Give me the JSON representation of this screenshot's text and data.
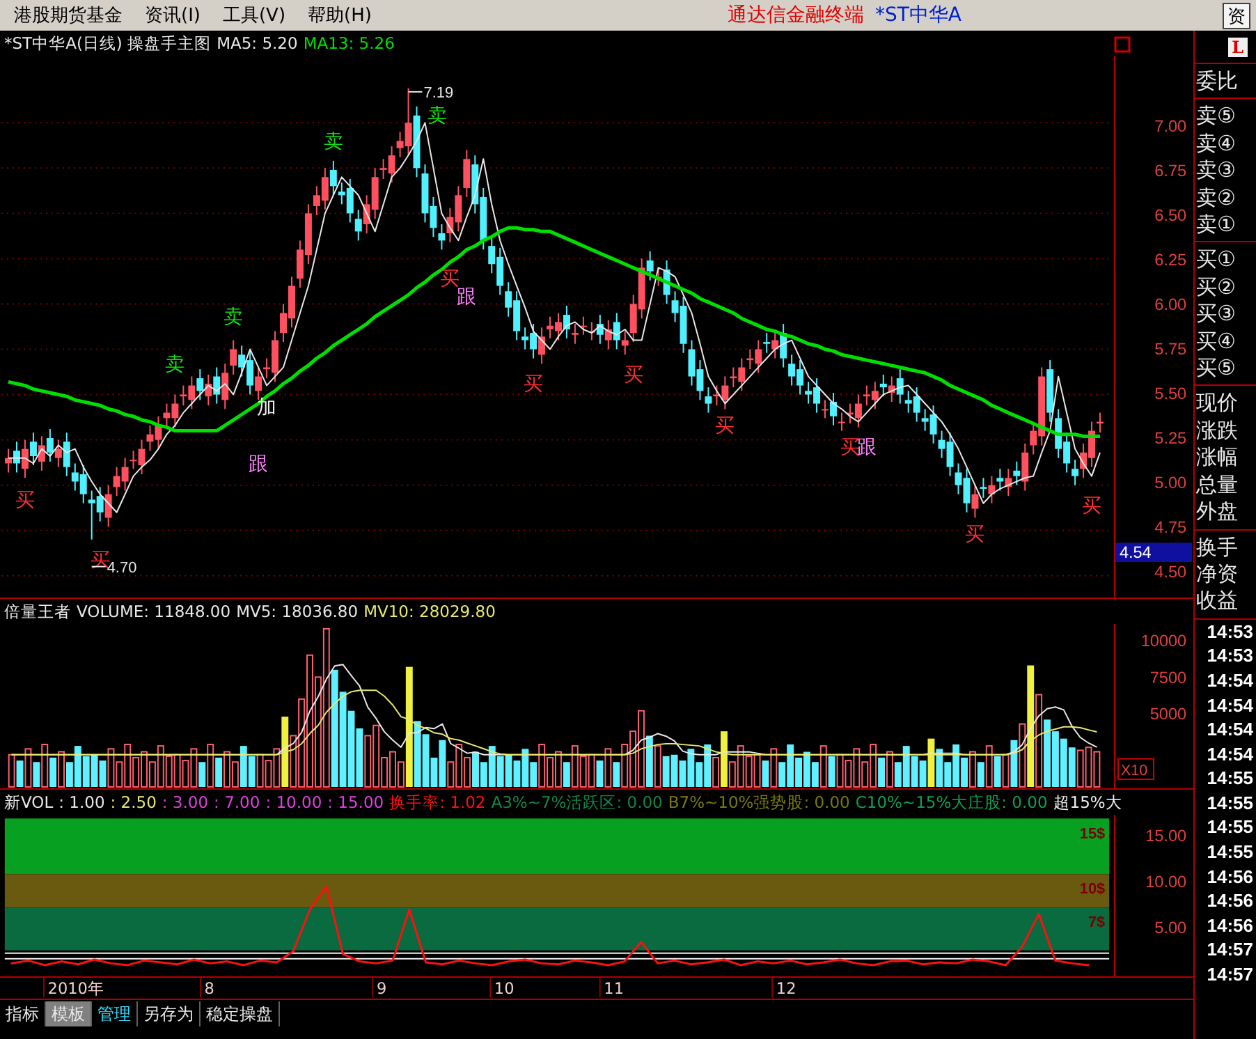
{
  "menu_bar": {
    "items": [
      "港股期货基金",
      "资讯(I)",
      "工具(V)",
      "帮助(H)"
    ],
    "app_title": "通达信金融终端",
    "stock_name": "*ST中华A",
    "corner_button": "资"
  },
  "price_pane": {
    "legend": [
      {
        "text": "*ST中华A(日线) 操盘手主图",
        "color": "#e8e8e8"
      }
    ],
    "current_price": "4.54",
    "chart_data": {
      "type": "candlestick",
      "ylim": [
        4.38,
        7.37
      ],
      "grid": true,
      "yticks": [
        {
          "value": 7,
          "label": "7.00"
        },
        {
          "value": 6.75,
          "label": "6.75"
        },
        {
          "value": 6.5,
          "label": "6.50"
        },
        {
          "value": 6.25,
          "label": "6.25"
        },
        {
          "value": 6,
          "label": "6.00"
        },
        {
          "value": 5.75,
          "label": "5.75"
        },
        {
          "value": 5.5,
          "label": "5.50"
        },
        {
          "value": 5.25,
          "label": "5.25"
        },
        {
          "value": 5,
          "label": "5.00"
        },
        {
          "value": 4.75,
          "label": "4.75"
        },
        {
          "value": 4.5,
          "label": "4.50"
        }
      ],
      "ohlc": [
        [
          5.12,
          5.2,
          5.07,
          5.15
        ],
        [
          5.19,
          5.24,
          5.07,
          5.12
        ],
        [
          5.09,
          5.25,
          5.04,
          5.2
        ],
        [
          5.24,
          5.29,
          5.11,
          5.16
        ],
        [
          5.13,
          5.27,
          5.08,
          5.22
        ],
        [
          5.26,
          5.31,
          5.13,
          5.18
        ],
        [
          5.15,
          5.25,
          5.1,
          5.2
        ],
        [
          5.24,
          5.29,
          5.05,
          5.1
        ],
        [
          5.07,
          5.12,
          4.97,
          5.02
        ],
        [
          5.06,
          5.11,
          4.9,
          4.95
        ],
        [
          4.92,
          4.97,
          4.7,
          4.9
        ],
        [
          4.94,
          4.99,
          4.8,
          4.85
        ],
        [
          4.82,
          5.0,
          4.77,
          4.95
        ],
        [
          4.99,
          5.1,
          4.94,
          5.05
        ],
        [
          5.02,
          5.15,
          4.97,
          5.1
        ],
        [
          5.14,
          5.19,
          5.09,
          5.14
        ],
        [
          5.11,
          5.25,
          5.06,
          5.2
        ],
        [
          5.24,
          5.33,
          5.19,
          5.28
        ],
        [
          5.25,
          5.38,
          5.2,
          5.33
        ],
        [
          5.37,
          5.45,
          5.32,
          5.4
        ],
        [
          5.37,
          5.5,
          5.32,
          5.45
        ],
        [
          5.49,
          5.55,
          5.44,
          5.5
        ],
        [
          5.47,
          5.6,
          5.42,
          5.55
        ],
        [
          5.59,
          5.64,
          5.47,
          5.52
        ],
        [
          5.49,
          5.61,
          5.44,
          5.56
        ],
        [
          5.6,
          5.65,
          5.45,
          5.5
        ],
        [
          5.47,
          5.67,
          5.42,
          5.62
        ],
        [
          5.66,
          5.8,
          5.61,
          5.75
        ],
        [
          5.72,
          5.77,
          5.6,
          5.65
        ],
        [
          5.69,
          5.74,
          5.5,
          5.55
        ],
        [
          5.52,
          5.65,
          5.47,
          5.6
        ],
        [
          5.64,
          5.7,
          5.59,
          5.65
        ],
        [
          5.62,
          5.85,
          5.57,
          5.8
        ],
        [
          5.84,
          6.0,
          5.79,
          5.95
        ],
        [
          5.92,
          6.15,
          5.87,
          6.1
        ],
        [
          6.14,
          6.35,
          6.09,
          6.3
        ],
        [
          6.27,
          6.55,
          6.22,
          6.5
        ],
        [
          6.54,
          6.65,
          6.49,
          6.6
        ],
        [
          6.57,
          6.75,
          6.52,
          6.7
        ],
        [
          6.74,
          6.79,
          6.6,
          6.65
        ],
        [
          6.62,
          6.67,
          6.55,
          6.6
        ],
        [
          6.64,
          6.69,
          6.45,
          6.5
        ],
        [
          6.47,
          6.52,
          6.35,
          6.4
        ],
        [
          6.44,
          6.6,
          6.39,
          6.55
        ],
        [
          6.52,
          6.75,
          6.47,
          6.7
        ],
        [
          6.74,
          6.8,
          6.69,
          6.75
        ],
        [
          6.72,
          6.87,
          6.67,
          6.82
        ],
        [
          6.86,
          6.95,
          6.81,
          6.9
        ],
        [
          6.87,
          7.19,
          6.82,
          7.0
        ],
        [
          7.04,
          7.09,
          6.7,
          6.75
        ],
        [
          6.72,
          6.77,
          6.45,
          6.5
        ],
        [
          6.54,
          6.59,
          6.37,
          6.42
        ],
        [
          6.39,
          6.44,
          6.3,
          6.35
        ],
        [
          6.39,
          6.53,
          6.34,
          6.48
        ],
        [
          6.45,
          6.65,
          6.4,
          6.6
        ],
        [
          6.64,
          6.85,
          6.59,
          6.8
        ],
        [
          6.77,
          6.82,
          6.5,
          6.55
        ],
        [
          6.59,
          6.64,
          6.3,
          6.35
        ],
        [
          6.32,
          6.37,
          6.17,
          6.22
        ],
        [
          6.26,
          6.31,
          6.05,
          6.1
        ],
        [
          6.07,
          6.12,
          5.93,
          5.98
        ],
        [
          6.02,
          6.07,
          5.8,
          5.85
        ],
        [
          5.82,
          5.87,
          5.75,
          5.8
        ],
        [
          5.84,
          5.89,
          5.7,
          5.75
        ],
        [
          5.72,
          5.87,
          5.67,
          5.82
        ],
        [
          5.86,
          5.93,
          5.81,
          5.88
        ],
        [
          5.85,
          5.95,
          5.8,
          5.9
        ],
        [
          5.94,
          5.99,
          5.81,
          5.86
        ],
        [
          5.83,
          5.89,
          5.78,
          5.84
        ],
        [
          5.88,
          5.93,
          5.83,
          5.88
        ],
        [
          5.85,
          5.9,
          5.8,
          5.85
        ],
        [
          5.89,
          5.94,
          5.78,
          5.83
        ],
        [
          5.8,
          5.91,
          5.75,
          5.86
        ],
        [
          5.9,
          5.95,
          5.75,
          5.8
        ],
        [
          5.77,
          5.85,
          5.72,
          5.8
        ],
        [
          5.84,
          6.05,
          5.79,
          6.0
        ],
        [
          5.97,
          6.25,
          5.92,
          6.2
        ],
        [
          6.24,
          6.29,
          6.13,
          6.18
        ],
        [
          6.15,
          6.2,
          6.1,
          6.15
        ],
        [
          6.19,
          6.24,
          6.0,
          6.05
        ],
        [
          6.02,
          6.07,
          5.9,
          5.95
        ],
        [
          5.99,
          6.04,
          5.73,
          5.78
        ],
        [
          5.75,
          5.8,
          5.55,
          5.6
        ],
        [
          5.64,
          5.69,
          5.47,
          5.52
        ],
        [
          5.49,
          5.54,
          5.4,
          5.45
        ],
        [
          5.49,
          5.55,
          5.44,
          5.5
        ],
        [
          5.47,
          5.6,
          5.42,
          5.55
        ],
        [
          5.59,
          5.65,
          5.54,
          5.6
        ],
        [
          5.57,
          5.7,
          5.52,
          5.65
        ],
        [
          5.69,
          5.75,
          5.64,
          5.7
        ],
        [
          5.67,
          5.8,
          5.62,
          5.75
        ],
        [
          5.79,
          5.84,
          5.73,
          5.78
        ],
        [
          5.75,
          5.85,
          5.7,
          5.8
        ],
        [
          5.84,
          5.89,
          5.65,
          5.7
        ],
        [
          5.67,
          5.72,
          5.55,
          5.6
        ],
        [
          5.64,
          5.69,
          5.5,
          5.55
        ],
        [
          5.52,
          5.57,
          5.45,
          5.5
        ],
        [
          5.54,
          5.59,
          5.4,
          5.45
        ],
        [
          5.42,
          5.47,
          5.37,
          5.42
        ],
        [
          5.46,
          5.51,
          5.33,
          5.38
        ],
        [
          5.35,
          5.4,
          5.3,
          5.35
        ],
        [
          5.39,
          5.45,
          5.34,
          5.4
        ],
        [
          5.37,
          5.5,
          5.32,
          5.45
        ],
        [
          5.49,
          5.55,
          5.44,
          5.5
        ],
        [
          5.47,
          5.57,
          5.42,
          5.52
        ],
        [
          5.56,
          5.61,
          5.49,
          5.54
        ],
        [
          5.51,
          5.6,
          5.46,
          5.55
        ],
        [
          5.59,
          5.64,
          5.45,
          5.5
        ],
        [
          5.47,
          5.52,
          5.4,
          5.45
        ],
        [
          5.49,
          5.54,
          5.35,
          5.4
        ],
        [
          5.37,
          5.42,
          5.3,
          5.35
        ],
        [
          5.39,
          5.44,
          5.23,
          5.28
        ],
        [
          5.25,
          5.3,
          5.15,
          5.2
        ],
        [
          5.24,
          5.29,
          5.05,
          5.1
        ],
        [
          5.07,
          5.12,
          4.95,
          5.0
        ],
        [
          5.04,
          5.09,
          4.85,
          4.9
        ],
        [
          4.87,
          5.0,
          4.82,
          4.95
        ],
        [
          4.99,
          5.04,
          4.93,
          4.98
        ],
        [
          4.95,
          5.05,
          4.9,
          5.0
        ],
        [
          5.04,
          5.09,
          4.97,
          5.02
        ],
        [
          4.99,
          5.09,
          4.94,
          5.04
        ],
        [
          5.08,
          5.13,
          5.0,
          5.05
        ],
        [
          5.02,
          5.23,
          4.97,
          5.18
        ],
        [
          5.22,
          5.35,
          5.17,
          5.3
        ],
        [
          5.27,
          5.65,
          5.22,
          5.6
        ],
        [
          5.64,
          5.69,
          5.35,
          5.4
        ],
        [
          5.37,
          5.42,
          5.15,
          5.2
        ],
        [
          5.24,
          5.29,
          5.07,
          5.12
        ],
        [
          5.09,
          5.14,
          5.0,
          5.05
        ],
        [
          5.09,
          5.23,
          5.04,
          5.18
        ],
        [
          5.15,
          5.35,
          5.1,
          5.3
        ],
        [
          5.34,
          5.4,
          5.29,
          5.35
        ]
      ],
      "series": [
        {
          "name": "MA5: 5.20",
          "type": "line",
          "color": "#e8e8e8",
          "values": [
            5.15,
            5.15,
            5.15,
            5.12,
            5.2,
            5.16,
            5.22,
            5.18,
            5.2,
            5.1,
            5.02,
            4.95,
            4.9,
            4.85,
            4.95,
            5.05,
            5.1,
            5.14,
            5.2,
            5.28,
            5.33,
            5.4,
            5.45,
            5.5,
            5.55,
            5.52,
            5.56,
            5.5,
            5.62,
            5.75,
            5.65,
            5.55,
            5.6,
            5.65,
            5.8,
            5.95,
            6.1,
            6.3,
            6.5,
            6.6,
            6.7,
            6.65,
            6.6,
            6.5,
            6.4,
            6.55,
            6.7,
            6.75,
            6.82,
            6.9,
            7.0,
            6.75,
            6.5,
            6.42,
            6.35,
            6.48,
            6.6,
            6.8,
            6.55,
            6.35,
            6.22,
            6.1,
            5.98,
            5.85,
            5.8,
            5.75,
            5.82,
            5.88,
            5.9,
            5.86,
            5.84,
            5.88,
            5.85,
            5.83,
            5.86,
            5.8,
            5.8,
            6.0,
            6.2,
            6.18,
            6.15,
            6.05,
            5.95,
            5.78,
            5.6,
            5.52,
            5.45,
            5.5,
            5.55,
            5.6,
            5.65,
            5.7,
            5.75,
            5.78,
            5.8,
            5.7,
            5.6,
            5.55,
            5.5,
            5.45,
            5.42,
            5.38,
            5.35,
            5.4,
            5.45,
            5.5,
            5.52,
            5.54,
            5.55,
            5.5,
            5.45,
            5.4,
            5.35,
            5.28,
            5.2,
            5.1,
            5.0,
            4.9,
            4.95,
            4.98,
            5.0,
            5.02,
            5.04,
            5.05,
            5.18,
            5.3,
            5.6,
            5.4,
            5.2,
            5.12,
            5.05,
            5.18
          ]
        },
        {
          "name": "MA13: 5.26",
          "type": "line",
          "color": "#00e000",
          "values": [
            5.57,
            5.56,
            5.55,
            5.53,
            5.52,
            5.51,
            5.5,
            5.49,
            5.47,
            5.46,
            5.45,
            5.44,
            5.42,
            5.41,
            5.39,
            5.38,
            5.36,
            5.35,
            5.33,
            5.32,
            5.3,
            5.3,
            5.3,
            5.3,
            5.3,
            5.3,
            5.33,
            5.36,
            5.39,
            5.42,
            5.45,
            5.49,
            5.52,
            5.56,
            5.59,
            5.63,
            5.66,
            5.7,
            5.73,
            5.77,
            5.8,
            5.83,
            5.86,
            5.89,
            5.93,
            5.96,
            5.99,
            6.02,
            6.05,
            6.09,
            6.12,
            6.16,
            6.19,
            6.23,
            6.26,
            6.3,
            6.32,
            6.35,
            6.37,
            6.4,
            6.42,
            6.42,
            6.41,
            6.41,
            6.4,
            6.4,
            6.38,
            6.36,
            6.34,
            6.32,
            6.3,
            6.28,
            6.26,
            6.24,
            6.22,
            6.2,
            6.18,
            6.16,
            6.14,
            6.12,
            6.1,
            6.08,
            6.06,
            6.03,
            6.01,
            5.99,
            5.97,
            5.95,
            5.92,
            5.9,
            5.88,
            5.86,
            5.85,
            5.83,
            5.82,
            5.8,
            5.78,
            5.77,
            5.75,
            5.74,
            5.72,
            5.71,
            5.7,
            5.69,
            5.68,
            5.67,
            5.66,
            5.65,
            5.64,
            5.63,
            5.62,
            5.6,
            5.58,
            5.55,
            5.53,
            5.51,
            5.49,
            5.47,
            5.44,
            5.42,
            5.4,
            5.38,
            5.36,
            5.34,
            5.32,
            5.3,
            5.28,
            5.28,
            5.28,
            5.27,
            5.27,
            5.27
          ]
        }
      ]
    },
    "markers": [
      {
        "text": "买",
        "kind": "buy"
      },
      {
        "text": "买",
        "kind": "buy"
      },
      {
        "text": "4.70",
        "kind": "low"
      },
      {
        "text": "卖",
        "kind": "sell"
      },
      {
        "text": "卖",
        "kind": "sell"
      },
      {
        "text": "加",
        "kind": "add"
      },
      {
        "text": "跟",
        "kind": "follow"
      },
      {
        "text": "卖",
        "kind": "sell"
      },
      {
        "text": "7.19",
        "kind": "high"
      },
      {
        "text": "卖",
        "kind": "sell"
      },
      {
        "text": "买",
        "kind": "buy"
      },
      {
        "text": "跟",
        "kind": "follow"
      },
      {
        "text": "买",
        "kind": "buy"
      },
      {
        "text": "买",
        "kind": "buy"
      },
      {
        "text": "买",
        "kind": "buy"
      },
      {
        "text": "买",
        "kind": "buy"
      },
      {
        "text": "跟",
        "kind": "follow"
      },
      {
        "text": "买",
        "kind": "buy"
      },
      {
        "text": "买",
        "kind": "buy"
      }
    ]
  },
  "volume_pane": {
    "legend": [
      {
        "text": "倍量王者",
        "color": "#e8e8e8"
      }
    ],
    "chart_data": {
      "type": "bar",
      "ylim": [
        0,
        11130
      ],
      "yticks": [
        {
          "value": 10000,
          "label": "10000"
        },
        {
          "value": 7500,
          "label": "7500"
        },
        {
          "value": 5000,
          "label": "5000"
        }
      ],
      "series": [
        {
          "name": "VOLUME: 11848.00",
          "type": "bar",
          "colors": [
            "#ff6070",
            "#60f0ff",
            "#ff6070",
            "#60f0ff",
            "#ff6070",
            "#60f0ff",
            "#ff6070",
            "#60f0ff",
            "#60f0ff",
            "#60f0ff",
            "#60f0ff",
            "#60f0ff",
            "#ff6070",
            "#ff6070",
            "#ff6070",
            "#ff6070",
            "#ff6070",
            "#ff6070",
            "#ff6070",
            "#ff6070",
            "#ff6070",
            "#ff6070",
            "#ff6070",
            "#60f0ff",
            "#ff6070",
            "#60f0ff",
            "#ff6070",
            "#ff6070",
            "#60f0ff",
            "#60f0ff",
            "#ff6070",
            "#ff6070",
            "#ff6070",
            "#f0f040",
            "#ff6070",
            "#ff6070",
            "#ff6070",
            "#ff6070",
            "#ff6070",
            "#60f0ff",
            "#60f0ff",
            "#60f0ff",
            "#60f0ff",
            "#ff6070",
            "#ff6070",
            "#ff6070",
            "#ff6070",
            "#ff6070",
            "#f0f040",
            "#60f0ff",
            "#60f0ff",
            "#60f0ff",
            "#60f0ff",
            "#ff6070",
            "#ff6070",
            "#ff6070",
            "#60f0ff",
            "#60f0ff",
            "#60f0ff",
            "#60f0ff",
            "#60f0ff",
            "#60f0ff",
            "#60f0ff",
            "#60f0ff",
            "#ff6070",
            "#ff6070",
            "#ff6070",
            "#60f0ff",
            "#ff6070",
            "#ff6070",
            "#ff6070",
            "#60f0ff",
            "#ff6070",
            "#60f0ff",
            "#ff6070",
            "#ff6070",
            "#ff6070",
            "#60f0ff",
            "#ff6070",
            "#60f0ff",
            "#60f0ff",
            "#60f0ff",
            "#60f0ff",
            "#60f0ff",
            "#60f0ff",
            "#ff6070",
            "#f0f040",
            "#ff6070",
            "#ff6070",
            "#ff6070",
            "#ff6070",
            "#60f0ff",
            "#ff6070",
            "#60f0ff",
            "#60f0ff",
            "#60f0ff",
            "#60f0ff",
            "#60f0ff",
            "#ff6070",
            "#60f0ff",
            "#ff6070",
            "#ff6070",
            "#ff6070",
            "#ff6070",
            "#ff6070",
            "#60f0ff",
            "#ff6070",
            "#60f0ff",
            "#60f0ff",
            "#60f0ff",
            "#60f0ff",
            "#f0f040",
            "#60f0ff",
            "#60f0ff",
            "#60f0ff",
            "#60f0ff",
            "#ff6070",
            "#60f0ff",
            "#ff6070",
            "#60f0ff",
            "#ff6070",
            "#60f0ff",
            "#ff6070",
            "#f0f040",
            "#ff6070",
            "#60f0ff",
            "#60f0ff",
            "#60f0ff",
            "#60f0ff",
            "#ff6070",
            "#ff6070",
            "#ff6070"
          ],
          "values": [
            2200,
            1800,
            2600,
            1700,
            2900,
            2000,
            2400,
            1700,
            2800,
            2100,
            2200,
            1800,
            2600,
            1700,
            2900,
            2000,
            2400,
            1700,
            2800,
            2100,
            2200,
            1800,
            2600,
            1700,
            2900,
            2000,
            2400,
            1700,
            2800,
            2100,
            2200,
            1800,
            2600,
            4800,
            3500,
            6000,
            9000,
            7500,
            10800,
            8000,
            6500,
            5200,
            4000,
            3500,
            4200,
            2000,
            2400,
            1700,
            8200,
            4500,
            3600,
            2000,
            3200,
            1700,
            2900,
            2000,
            2400,
            1700,
            2800,
            2100,
            2200,
            1800,
            2600,
            1700,
            2900,
            2000,
            2400,
            1700,
            2800,
            2100,
            2200,
            1800,
            2600,
            1700,
            2900,
            3800,
            5200,
            3500,
            2800,
            2100,
            2200,
            1800,
            2600,
            1700,
            2900,
            2000,
            3800,
            1700,
            2800,
            2100,
            2200,
            1800,
            2600,
            1700,
            2900,
            2000,
            2400,
            1700,
            2800,
            2100,
            2200,
            1800,
            2600,
            1700,
            2900,
            2000,
            2400,
            1700,
            2800,
            2100,
            1800,
            3300,
            2600,
            1700,
            2900,
            2000,
            2400,
            1700,
            2800,
            2100,
            2200,
            3200,
            4300,
            8300,
            6300,
            4600,
            3800,
            3300,
            2700,
            2500,
            2700,
            2400
          ]
        },
        {
          "name": "MV5: 18036.80",
          "type": "line",
          "color": "#e8e8e8",
          "values": [
            2200,
            2200,
            2200,
            2200,
            2200,
            2200,
            2200,
            2200,
            2200,
            2200,
            2200,
            2200,
            2200,
            2200,
            2200,
            2200,
            2200,
            2200,
            2200,
            2200,
            2200,
            2200,
            2200,
            2200,
            2200,
            2200,
            2200,
            2200,
            2200,
            2200,
            2200,
            2200,
            2200,
            2660,
            2960,
            3720,
            5180,
            6160,
            7360,
            8260,
            8360,
            7600,
            6900,
            5440,
            4680,
            3760,
            3200,
            2720,
            3660,
            3720,
            4060,
            3980,
            4300,
            2960,
            2640,
            2300,
            2380,
            2200,
            2200,
            2200,
            2200,
            2200,
            2200,
            2200,
            2200,
            2200,
            2200,
            2200,
            2200,
            2200,
            2200,
            2200,
            2200,
            2200,
            2200,
            2500,
            3200,
            3380,
            3640,
            3460,
            3140,
            2440,
            2260,
            2200,
            2200,
            2200,
            2400,
            2400,
            2400,
            2400,
            2300,
            2200,
            2200,
            2200,
            2200,
            2200,
            2200,
            2200,
            2200,
            2200,
            2200,
            2200,
            2200,
            2200,
            2200,
            2200,
            2200,
            2200,
            2200,
            2200,
            2200,
            2300,
            2300,
            2300,
            2300,
            2200,
            2200,
            2200,
            2200,
            2200,
            2200,
            2400,
            2900,
            4000,
            4860,
            5340,
            5460,
            5260,
            4140,
            3380,
            3000,
            2720
          ]
        },
        {
          "name": "MV10: 28029.80",
          "type": "line",
          "color": "#e8e870",
          "values": [
            2200,
            2200,
            2200,
            2200,
            2200,
            2200,
            2200,
            2200,
            2200,
            2200,
            2200,
            2200,
            2200,
            2200,
            2200,
            2200,
            2200,
            2200,
            2200,
            2200,
            2200,
            2200,
            2200,
            2200,
            2200,
            2200,
            2200,
            2200,
            2200,
            2200,
            2200,
            2200,
            2200,
            2400,
            2550,
            2950,
            3650,
            4200,
            5100,
            5700,
            6200,
            6500,
            6600,
            6600,
            6600,
            6200,
            5600,
            4800,
            4600,
            4200,
            4000,
            3700,
            3600,
            3300,
            3200,
            3000,
            2800,
            2600,
            2400,
            2250,
            2200,
            2200,
            2200,
            2200,
            2200,
            2200,
            2200,
            2200,
            2200,
            2200,
            2200,
            2200,
            2200,
            2200,
            2200,
            2300,
            2600,
            2750,
            2900,
            2950,
            2950,
            2900,
            2850,
            2800,
            2600,
            2400,
            2300,
            2200,
            2200,
            2200,
            2200,
            2200,
            2200,
            2200,
            2200,
            2200,
            2200,
            2200,
            2200,
            2200,
            2200,
            2200,
            2200,
            2200,
            2200,
            2200,
            2200,
            2200,
            2200,
            2200,
            2200,
            2200,
            2200,
            2200,
            2200,
            2200,
            2200,
            2200,
            2200,
            2200,
            2200,
            2300,
            2550,
            3150,
            3550,
            3800,
            3950,
            4100,
            4100,
            4050,
            3900,
            3750
          ]
        }
      ]
    },
    "scale_label": "X10"
  },
  "indicator_pane": {
    "legend": [
      {
        "text": "新VOL",
        "color": "#e8e8e8"
      },
      {
        "text": ": 1.00",
        "color": "#e8e8e8"
      },
      {
        "text": ": 2.50",
        "color": "#e8e870"
      },
      {
        "text": ": 3.00",
        "color": "#e040e0"
      },
      {
        "text": ": 7.00",
        "color": "#e040e0"
      },
      {
        "text": ": 10.00",
        "color": "#e040e0"
      },
      {
        "text": ": 15.00",
        "color": "#e040e0"
      }
    ],
    "chart_data": {
      "type": "line",
      "ylim": [
        -0.2,
        17.2
      ],
      "yticks": [
        {
          "value": 15,
          "label": "15.00"
        },
        {
          "value": 10,
          "label": "10.00"
        },
        {
          "value": 5,
          "label": "5.00"
        }
      ],
      "bands": [
        {
          "axis": "y",
          "from": 10.8,
          "to": 16.8,
          "color": "#08a020"
        },
        {
          "axis": "y",
          "from": 7.2,
          "to": 10.8,
          "color": "#6a5a10"
        },
        {
          "axis": "y",
          "from": 2.6,
          "to": 7.2,
          "color": "#0a6a40"
        }
      ],
      "ref_lines": [
        {
          "axis": "y",
          "value": 2.3,
          "color": "#f0f0f0"
        },
        {
          "axis": "y",
          "value": 1.7,
          "color": "#f0f0f0"
        }
      ],
      "series": [
        {
          "name": "换手率: 1.02",
          "color": "#ff1010",
          "values": [
            1.2,
            1.5,
            1.0,
            1.4,
            1.1,
            1.6,
            1.2,
            1.0,
            1.5,
            1.3,
            1.1,
            1.6,
            1.2,
            1.4,
            1.0,
            1.5,
            1.3,
            2.5,
            7,
            9.5,
            2.2,
            1.4,
            1.2,
            1.5,
            7,
            1.3,
            1.1,
            1.5,
            1.2,
            1.0,
            1.4,
            1.6,
            1.2,
            1.1,
            1.5,
            1.3,
            1.0,
            1.4,
            3.5,
            1.2,
            1.5,
            1.1,
            1.3,
            1.6,
            1.0,
            1.4,
            1.2,
            1.5,
            1.1,
            1.3,
            1.6,
            1.2,
            1.0,
            1.4,
            1.5,
            1.1,
            1.3,
            1.2,
            1.6,
            1.4,
            1.0,
            3,
            6.5,
            1.5,
            1.2,
            1.0
          ]
        }
      ]
    },
    "band_labels": [
      "15$",
      "10$",
      "7$"
    ],
    "legend_end": [
      {
        "text": "A3%~7%活跃区: 0.00",
        "color": "#108848"
      },
      {
        "text": "B7%~10%强势股: 0.00",
        "color": "#7a7a10"
      },
      {
        "text": "C10%~15%大庄股: 0.00",
        "color": "#10a050"
      },
      {
        "text": "超15%大",
        "color": "#f0f0f0"
      }
    ]
  },
  "date_axis": [
    "2010年",
    "8",
    "9",
    "10",
    "11",
    "12"
  ],
  "side_panel": {
    "badge": "L",
    "groups": [
      [
        "委比"
      ],
      [
        "卖⑤",
        "卖④",
        "卖③",
        "卖②",
        "卖①"
      ],
      [
        "买①",
        "买②",
        "买③",
        "买④",
        "买⑤"
      ],
      [
        "现价",
        "涨跌",
        "涨幅",
        "总量",
        "外盘"
      ],
      [
        "换手",
        "净资",
        "收益"
      ]
    ],
    "times": [
      "14:53",
      "14:53",
      "14:54",
      "14:54",
      "14:54",
      "14:54",
      "14:55",
      "14:55",
      "14:55",
      "14:55",
      "14:56",
      "14:56",
      "14:56",
      "14:57",
      "14:57"
    ]
  },
  "bottom_tabs": [
    {
      "label": "指标",
      "selected": false,
      "highlighted": false
    },
    {
      "label": "模板",
      "selected": true,
      "highlighted": false
    },
    {
      "label": "管理",
      "selected": false,
      "highlighted": true
    },
    {
      "label": "另存为",
      "selected": false,
      "highlighted": false
    },
    {
      "label": "稳定操盘",
      "selected": false,
      "highlighted": false
    }
  ]
}
